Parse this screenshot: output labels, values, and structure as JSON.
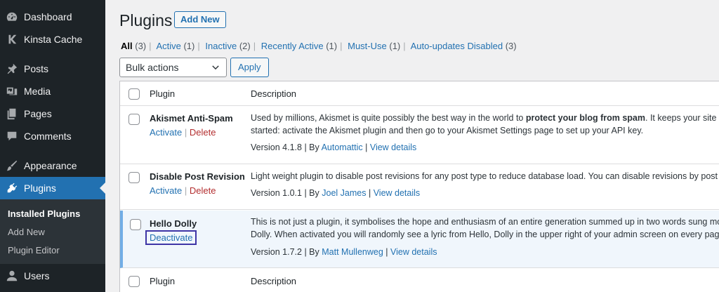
{
  "sidebar": {
    "items": [
      {
        "label": "Dashboard",
        "icon": "dashboard-icon"
      },
      {
        "label": "Kinsta Cache",
        "icon": "kinsta-icon"
      },
      {
        "label": "Posts",
        "icon": "pin-icon"
      },
      {
        "label": "Media",
        "icon": "media-icon"
      },
      {
        "label": "Pages",
        "icon": "pages-icon"
      },
      {
        "label": "Comments",
        "icon": "comments-icon"
      },
      {
        "label": "Appearance",
        "icon": "brush-icon"
      },
      {
        "label": "Plugins",
        "icon": "plugin-icon"
      },
      {
        "label": "Users",
        "icon": "users-icon"
      }
    ],
    "submenu": [
      "Installed Plugins",
      "Add New",
      "Plugin Editor"
    ]
  },
  "page": {
    "title": "Plugins",
    "add_new": "Add New"
  },
  "filters": [
    {
      "label": "All",
      "count": "(3)"
    },
    {
      "label": "Active",
      "count": "(1)"
    },
    {
      "label": "Inactive",
      "count": "(2)"
    },
    {
      "label": "Recently Active",
      "count": "(1)"
    },
    {
      "label": "Must-Use",
      "count": "(1)"
    },
    {
      "label": "Auto-updates Disabled",
      "count": "(3)"
    }
  ],
  "bulk": {
    "selected": "Bulk actions",
    "apply": "Apply"
  },
  "table": {
    "col_plugin": "Plugin",
    "col_description": "Description",
    "rows": [
      {
        "name": "Akismet Anti-Spam",
        "action1": "Activate",
        "action2": "Delete",
        "desc_line1_a": "Used by millions, Akismet is quite possibly the best way in the world to ",
        "desc_line1_b": "protect your blog from spam",
        "desc_line1_c": ". It keeps your site protected",
        "desc_line2": "started: activate the Akismet plugin and then go to your Akismet Settings page to set up your API key.",
        "version": "Version 4.1.8",
        "by": "By",
        "author": "Automattic",
        "details": "View details"
      },
      {
        "name": "Disable Post Revision",
        "action1": "Activate",
        "action2": "Delete",
        "desc_line1": "Light weight plugin to disable post revisions for any post type to reduce database load. You can disable revisions by post type.",
        "version": "Version 1.0.1",
        "by": "By",
        "author": "Joel James",
        "details": "View details"
      },
      {
        "name": "Hello Dolly",
        "action1": "Deactivate",
        "desc_line1": "This is not just a plugin, it symbolises the hope and enthusiasm of an entire generation summed up in two words sung most famo",
        "desc_line2": "Dolly. When activated you will randomly see a lyric from Hello, Dolly in the upper right of your admin screen on every page.",
        "version": "Version 1.7.2",
        "by": "By",
        "author": "Matt Mullenweg",
        "details": "View details"
      }
    ]
  },
  "colors": {
    "accent": "#2271b1",
    "sidebar_bg": "#1d2327",
    "delete": "#b32d2e",
    "highlight_box": "#3f35a6"
  }
}
